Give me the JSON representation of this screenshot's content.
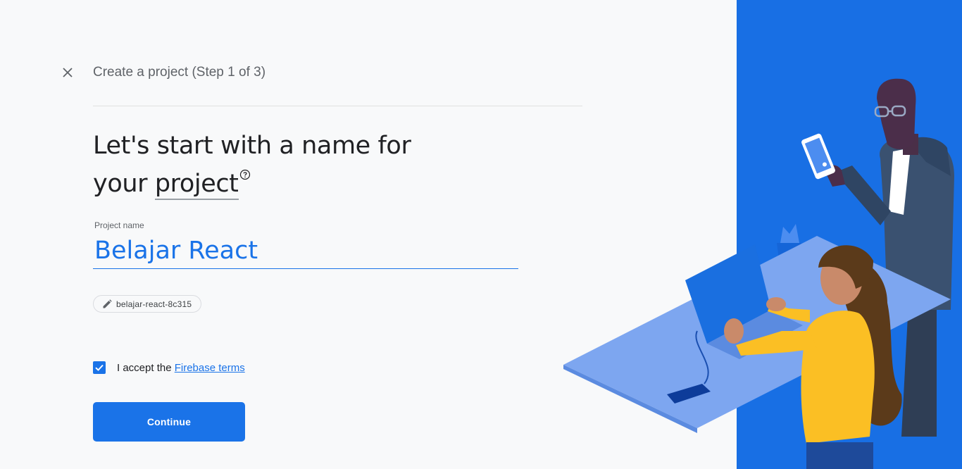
{
  "header": {
    "close_icon": "close-icon",
    "step_title": "Create a project (Step 1 of 3)"
  },
  "heading": {
    "line1": "Let's start with a name for",
    "line2_prefix": "your ",
    "line2_link": "project",
    "help_icon": "help-circle-icon"
  },
  "project_name": {
    "label": "Project name",
    "value": "Belajar React"
  },
  "project_id_chip": {
    "icon": "pencil-icon",
    "text": "belajar-react-8c315"
  },
  "terms": {
    "checked": true,
    "prefix": "I accept the ",
    "link": "Firebase terms"
  },
  "actions": {
    "continue_label": "Continue"
  },
  "colors": {
    "primary": "#1a73e8",
    "background": "#f8f9fa",
    "illustration_bg": "#1a73e8",
    "text": "#202124",
    "muted": "#5f6368"
  }
}
